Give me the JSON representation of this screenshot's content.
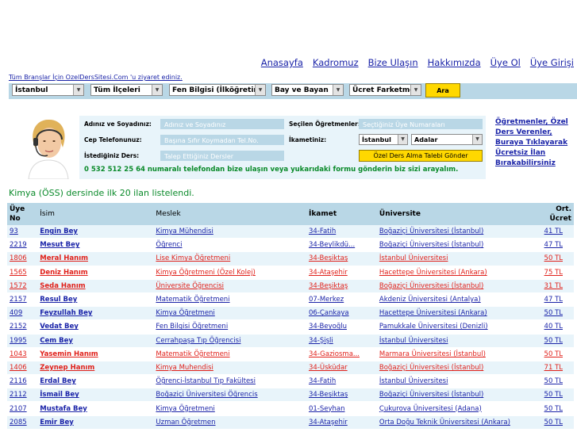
{
  "nav": {
    "links": [
      "Anasayfa",
      "Kadromuz",
      "Bize Ulaşın",
      "Hakkımızda",
      "Üye Ol",
      "Üye Girişi"
    ]
  },
  "promo_text": "Tüm Branşlar İçin OzelDersSitesi.Com 'u ziyaret ediniz.",
  "filters": {
    "city": "İstanbul",
    "district": "Tüm İlçeleri",
    "subject": "Fen Bilgisi (İlköğretim)",
    "gender": "Bay ve Bayan",
    "fee": "Ücret Farketmez",
    "search_button": "Ara"
  },
  "contact_form": {
    "name_label": "Adınız ve Soyadınız:",
    "name_placeholder": "Adınız ve Soyadınız",
    "phone_label": "Cep Telefonunuz:",
    "phone_placeholder": "Başına Sıfır Koymadan Tel.No.",
    "lesson_label": "İstediğiniz Ders:",
    "lesson_placeholder": "Talep Ettiğiniz Dersler",
    "teachers_label": "Seçilen Öğretmenler:",
    "teachers_placeholder": "Seçtiğiniz Üye Numaraları",
    "residence_label": "İkametiniz:",
    "residence_city": "İstanbul",
    "residence_district": "Adalar",
    "submit_button": "Özel Ders Alma Talebi Gönder",
    "phone_note": "0 532 512 25 64 numaralı telefondan bize ulaşın veya yukarıdaki formu gönderin biz sizi arayalım."
  },
  "side_link": "Öğretmenler, Özel Ders Verenler, Buraya Tıklayarak Ücretsiz İlan Bırakabilirsiniz",
  "listing": {
    "count_text": "Kimya (ÖSS) dersinde ilk 20 ilan listelendi.",
    "headers": {
      "no_line1": "Üye",
      "no_line2": "No",
      "name": "İsim",
      "job": "Meslek",
      "residence": "İkamet",
      "university": "Üniversite",
      "fee_line1": "Ort.",
      "fee_line2": "Ücret"
    },
    "rows": [
      {
        "no": "93",
        "name": "Engin Bey",
        "job": "Kimya Mühendisi",
        "residence": "34-Fatih",
        "university": "Boğaziçi Üniversitesi (İstanbul)",
        "fee": "41 TL",
        "color": "blue"
      },
      {
        "no": "2219",
        "name": "Mesut Bey",
        "job": "Öğrenci",
        "residence": "34-Beylikdü...",
        "university": "Boğaziçi Üniversitesi (İstanbul)",
        "fee": "47 TL",
        "color": "blue"
      },
      {
        "no": "1806",
        "name": "Meral Hanım",
        "job": "Lise Kimya Öğretmeni",
        "residence": "34-Beşiktaş",
        "university": "İstanbul Üniversitesi",
        "fee": "50 TL",
        "color": "red"
      },
      {
        "no": "1565",
        "name": "Deniz Hanım",
        "job": "Kimya Öğretmeni (Özel Kolej)",
        "residence": "34-Ataşehir",
        "university": "Hacettepe Üniversitesi (Ankara)",
        "fee": "75 TL",
        "color": "red"
      },
      {
        "no": "1572",
        "name": "Seda Hanım",
        "job": "Üniversite Öğrencisi",
        "residence": "34-Beşiktaş",
        "university": "Boğaziçi Üniversitesi (İstanbul)",
        "fee": "31 TL",
        "color": "red"
      },
      {
        "no": "2157",
        "name": "Resul Bey",
        "job": "Matematik Öğretmeni",
        "residence": "07-Merkez",
        "university": "Akdeniz Üniversitesi (Antalya)",
        "fee": "47 TL",
        "color": "blue"
      },
      {
        "no": "409",
        "name": "Feyzullah Bey",
        "job": "Kimya Öğretmeni",
        "residence": "06-Çankaya",
        "university": "Hacettepe Üniversitesi (Ankara)",
        "fee": "50 TL",
        "color": "blue"
      },
      {
        "no": "2152",
        "name": "Vedat Bey",
        "job": "Fen Bilgisi Öğretmeni",
        "residence": "34-Beyoğlu",
        "university": "Pamukkale Üniversitesi (Denizli)",
        "fee": "40 TL",
        "color": "blue"
      },
      {
        "no": "1995",
        "name": "Cem Bey",
        "job": "Cerrahpaşa Tıp Öğrencisi",
        "residence": "34-Şişli",
        "university": "İstanbul Üniversitesi",
        "fee": "50 TL",
        "color": "blue"
      },
      {
        "no": "1043",
        "name": "Yasemin Hanım",
        "job": "Matematik Öğretmeni",
        "residence": "34-Gaziosma...",
        "university": "Marmara Üniversitesi (İstanbul)",
        "fee": "50 TL",
        "color": "red"
      },
      {
        "no": "1406",
        "name": "Zeynep Hanım",
        "job": "Kimya Muhendisi",
        "residence": "34-Üsküdar",
        "university": "Boğaziçi Üniversitesi (İstanbul)",
        "fee": "71 TL",
        "color": "red"
      },
      {
        "no": "2116",
        "name": "Erdal Bey",
        "job": "Öğrenci-İstanbul Tıp Fakültesi",
        "residence": "34-Fatih",
        "university": "İstanbul Üniversitesi",
        "fee": "50 TL",
        "color": "blue"
      },
      {
        "no": "2112",
        "name": "İsmail Bey",
        "job": "Boğaziçi Üniversitesi Öğrencis",
        "residence": "34-Beşiktaş",
        "university": "Boğaziçi Üniversitesi (İstanbul)",
        "fee": "50 TL",
        "color": "blue"
      },
      {
        "no": "2107",
        "name": "Mustafa Bey",
        "job": "Kimya Öğretmeni",
        "residence": "01-Seyhan",
        "university": "Çukurova Üniversitesi (Adana)",
        "fee": "50 TL",
        "color": "blue"
      },
      {
        "no": "2085",
        "name": "Emir Bey",
        "job": "Uzman Öğretmen",
        "residence": "34-Ataşehir",
        "university": "Orta Doğu Teknik Üniversitesi (Ankara)",
        "fee": "50 TL",
        "color": "blue"
      }
    ]
  },
  "colors": {
    "header_bg": "#b9d7e6",
    "row_alt_bg": "#e8f4fa",
    "link_blue": "#1a23a8",
    "link_red": "#e0201a",
    "note_green": "#0a8a2a",
    "button_yellow": "#ffd800"
  }
}
